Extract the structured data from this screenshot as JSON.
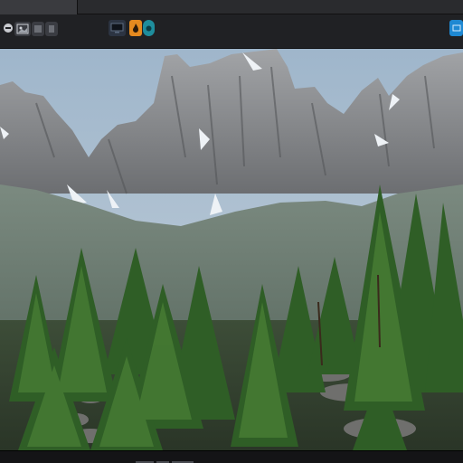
{
  "window": {
    "toolbar_left_icons": [
      "app-icon",
      "image-icon",
      "layers-icon",
      "panel-icon"
    ],
    "toolbar_center_icons": [
      "display-icon",
      "flame-icon",
      "record-icon"
    ],
    "toolbar_right_icon": "window-icon",
    "sub_toolbar_icons": [
      "tool-1",
      "tool-2",
      "tool-3",
      "tool-4",
      "tool-5",
      "tool-6",
      "tool-7",
      "tool-8",
      "tool-9"
    ]
  },
  "viewport": {
    "content": "mountain-forest-render",
    "colors": {
      "sky": "#a7bdd0",
      "rock": "#8a8c90",
      "forest_far": "#5f6d64",
      "tree": "#3a6e2e"
    }
  },
  "accent_colors": {
    "orange": "#e58a1f",
    "teal": "#1e8d9c",
    "blue": "#1e88d2"
  }
}
